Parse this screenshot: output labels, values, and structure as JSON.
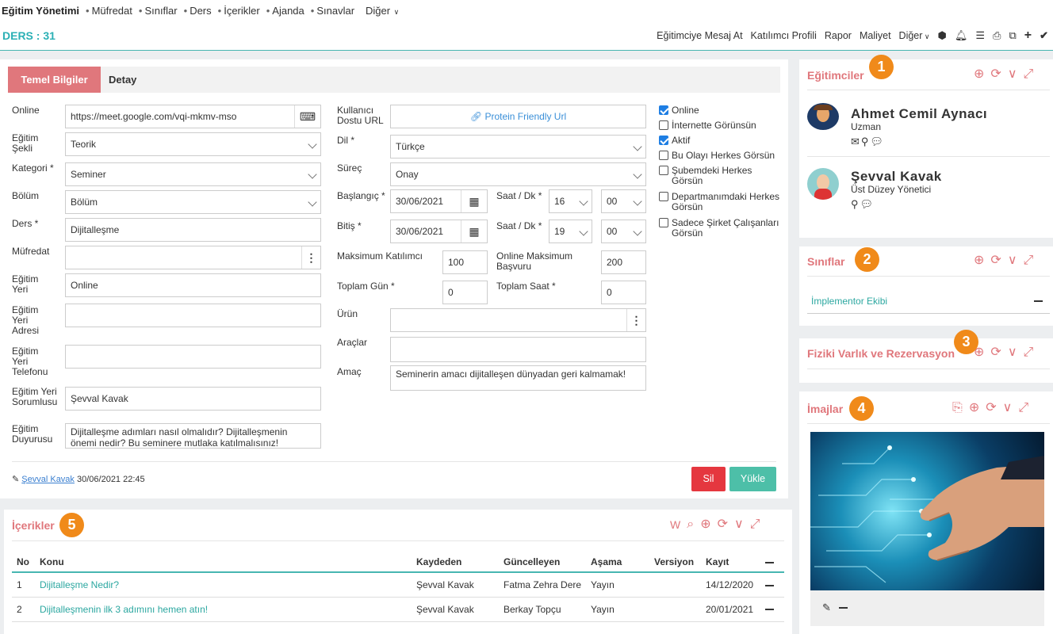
{
  "topnav": {
    "brand": "Eğitim Yönetimi",
    "items": [
      "Müfredat",
      "Sınıflar",
      "Ders",
      "İçerikler",
      "Ajanda",
      "Sınavlar"
    ],
    "more": "Diğer"
  },
  "header": {
    "title": "DERS : 31",
    "actions": [
      "Eğitimciye Mesaj At",
      "Katılımcı Profili",
      "Rapor",
      "Maliyet",
      "Diğer"
    ]
  },
  "tabs": {
    "active": "Temel Bilgiler",
    "other": "Detay"
  },
  "left": {
    "online_label": "Online",
    "online_value": "https://meet.google.com/vqi-mkmv-mso",
    "sekil_label": "Eğitim Şekli",
    "sekil_value": "Teorik",
    "kategori_label": "Kategori *",
    "kategori_value": "Seminer",
    "bolum_label": "Bölüm",
    "bolum_value": "Bölüm",
    "ders_label": "Ders *",
    "ders_value": "Dijitalleşme",
    "mufredat_label": "Müfredat",
    "mufredat_value": "",
    "yeri_label": "Eğitim Yeri",
    "yeri_value": "Online",
    "adres_label": "Eğitim Yeri Adresi",
    "adres_value": "",
    "telefon_label": "Eğitim Yeri Telefonu",
    "telefon_value": "",
    "sorumlu_label": "Eğitim Yeri Sorumlusu",
    "sorumlu_value": "Şevval Kavak",
    "duyuru_label": "Eğitim Duyurusu",
    "duyuru_value": "Dijitalleşme adımları nasıl olmalıdır? Dijitalleşmenin önemi nedir? Bu seminere mutlaka katılmalısınız!"
  },
  "mid": {
    "url_label": "Kullanıcı Dostu URL",
    "url_button": "Protein Friendly Url",
    "dil_label": "Dil *",
    "dil_value": "Türkçe",
    "surec_label": "Süreç",
    "surec_value": "Onay",
    "baslangic_label": "Başlangıç *",
    "baslangic_value": "30/06/2021",
    "saat_label": "Saat / Dk *",
    "baslangic_saat": "16",
    "baslangic_dk": "00",
    "bitis_label": "Bitiş *",
    "bitis_value": "30/06/2021",
    "bitis_saat": "19",
    "bitis_dk": "00",
    "max_label": "Maksimum Katılımcı",
    "max_value": "100",
    "online_max_label": "Online Maksimum Başvuru",
    "online_max_value": "200",
    "gun_label": "Toplam Gün *",
    "gun_value": "0",
    "saat_total_label": "Toplam Saat *",
    "saat_total_value": "0",
    "urun_label": "Ürün",
    "urun_value": "",
    "araclar_label": "Araçlar",
    "araclar_value": "",
    "amac_label": "Amaç",
    "amac_value": "Seminerin amacı dijitalleşen dünyadan geri kalmamak!"
  },
  "checks": [
    {
      "label": "Online",
      "checked": true
    },
    {
      "label": "İnternette Görünsün",
      "checked": false
    },
    {
      "label": "Aktif",
      "checked": true
    },
    {
      "label": "Bu Olayı Herkes Görsün",
      "checked": false
    },
    {
      "label": "Şubemdeki Herkes Görsün",
      "checked": false
    },
    {
      "label": "Departmanımdaki Herkes Görsün",
      "checked": false
    },
    {
      "label": "Sadece Şirket Çalışanları Görsün",
      "checked": false
    }
  ],
  "footer": {
    "editor": "Şevval Kavak",
    "date": "30/06/2021 22:45",
    "delete": "Sil",
    "upload": "Yükle"
  },
  "egitimciler": {
    "title": "Eğitimciler",
    "badge": "1",
    "people": [
      {
        "name": "Ahmet Cemil Aynacı",
        "role": "Uzman"
      },
      {
        "name": "Şevval Kavak",
        "role": "Üst Düzey Yönetici"
      }
    ]
  },
  "siniflar": {
    "title": "Sınıflar",
    "badge": "2",
    "item": "İmplementor Ekibi"
  },
  "fiziki": {
    "title": "Fiziki Varlık ve Rezervasyon",
    "badge": "3"
  },
  "imajlar": {
    "title": "İmajlar",
    "badge": "4"
  },
  "icerikler": {
    "title": "İçerikler",
    "badge": "5",
    "w": "W",
    "columns": [
      "No",
      "Konu",
      "Kaydeden",
      "Güncelleyen",
      "Aşama",
      "Versiyon",
      "Kayıt"
    ],
    "rows": [
      {
        "no": "1",
        "konu": "Dijitalleşme Nedir?",
        "kaydeden": "Şevval Kavak",
        "guncelleyen": "Fatma Zehra Dere",
        "asama": "Yayın",
        "versiyon": "",
        "kayit": "14/12/2020"
      },
      {
        "no": "2",
        "konu": "Dijitalleşmenin ilk 3 adımını hemen atın!",
        "kaydeden": "Şevval Kavak",
        "guncelleyen": "Berkay Topçu",
        "asama": "Yayın",
        "versiyon": "",
        "kayit": "20/01/2021"
      }
    ]
  },
  "colors": {
    "accent": "#e0777c",
    "teal": "#47b6b1",
    "badge": "#f08a1a",
    "delete": "#e5373f",
    "upload": "#4dbfa8"
  }
}
